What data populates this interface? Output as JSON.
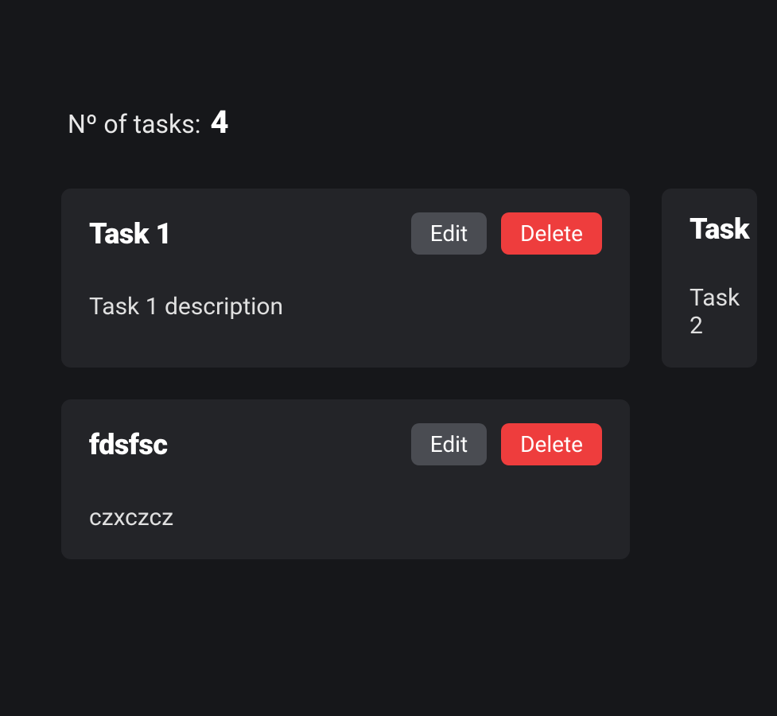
{
  "header": {
    "count_label": "Nº of tasks:",
    "count_value": "4"
  },
  "buttons": {
    "edit": "Edit",
    "delete": "Delete"
  },
  "tasks": [
    {
      "title": "Task 1",
      "description": "Task 1 description"
    },
    {
      "title": "Task",
      "description": "Task 2"
    },
    {
      "title": "fdsfsc",
      "description": "czxczcz"
    }
  ]
}
